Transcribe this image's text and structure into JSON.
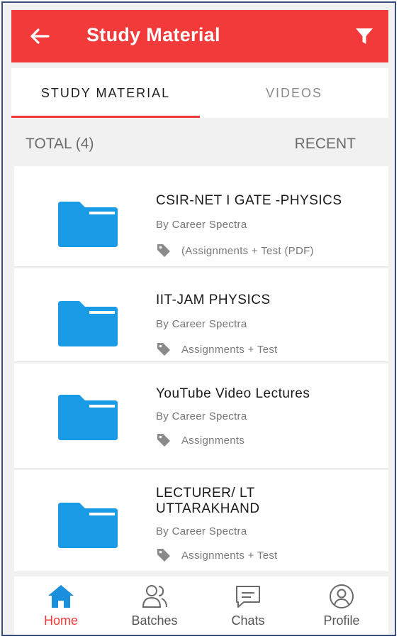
{
  "appbar": {
    "title": "Study Material"
  },
  "tabs": [
    {
      "label": "STUDY MATERIAL",
      "active": true
    },
    {
      "label": "VIDEOS",
      "active": false
    }
  ],
  "summary": {
    "total": "TOTAL (4)",
    "sort": "RECENT"
  },
  "items": [
    {
      "name": "CSIR-NET I GATE -PHYSICS",
      "by": "By Career Spectra",
      "tag": "(Assignments + Test (PDF)"
    },
    {
      "name": "IIT-JAM PHYSICS",
      "by": "By Career Spectra",
      "tag": "Assignments + Test"
    },
    {
      "name": "YouTube Video Lectures",
      "by": "By Career Spectra",
      "tag": "Assignments"
    },
    {
      "name_line1": "LECTURER/ LT",
      "name_line2": "UTTARAKHAND",
      "by": "By Career Spectra",
      "tag": "Assignments + Test"
    }
  ],
  "nav": [
    {
      "label": "Home",
      "icon": "home-icon",
      "active": true
    },
    {
      "label": "Batches",
      "icon": "batches-icon",
      "active": false
    },
    {
      "label": "Chats",
      "icon": "chats-icon",
      "active": false
    },
    {
      "label": "Profile",
      "icon": "profile-icon",
      "active": false
    }
  ],
  "colors": {
    "accent": "#f33a3a",
    "folder": "#1a9be6"
  }
}
